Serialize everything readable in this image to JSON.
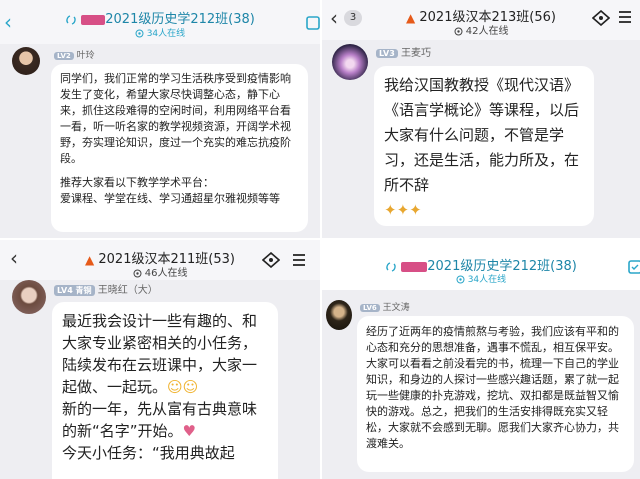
{
  "p1": {
    "title": "2021级历史学212班(38)",
    "online": "34人在线",
    "sender_badge": "LV2",
    "sender_name": "叶玲",
    "message": "同学们，我们正常的学习生活秩序受到疫情影响发生了变化，希望大家尽快调整心态，静下心来，抓住这段难得的空闲时间，利用网络平台看一看，听一听名家的教学视频资源，开阔学术视野，夯实理论知识，度过一个充实的难忘抗疫阶段。",
    "message2": "推荐大家看以下教学学术平台：\n爱课程、学堂在线、学习通超星尔雅视频等等"
  },
  "p2": {
    "unread": "3",
    "title": "2021级汉本213班(56)",
    "online": "42人在线",
    "sender_badge": "LV3",
    "sender_name": "王麦巧",
    "message": "我给汉国教教授《现代汉语》《语言学概论》等课程，以后大家有什么问题，不管是学习，还是生活，能力所及，在所不辞"
  },
  "p3": {
    "title": "2021级汉本211班(53)",
    "online": "46人在线",
    "sender_badge": "LV4 青铜",
    "sender_name": "王晓红（大）",
    "message": "最近我会设计一些有趣的、和大家专业紧密相关的小任务，陆续发布在云班课中，大家一起做、一起玩。",
    "message2": "新的一年，先从富有古典意味的新“名字”开始。",
    "message3": "今天小任务：“我用典故起"
  },
  "p4": {
    "title": "2021级历史学212班(38)",
    "online": "34人在线",
    "sender_badge": "LV6",
    "sender_name": "王文涛",
    "message": "经历了近两年的疫情煎熬与考验，我们应该有平和的心态和充分的思想准备，遇事不慌乱，相互保平安。大家可以看看之前没看完的书，梳理一下自己的学业知识，和身边的人探讨一些感兴趣话题，累了就一起玩一些健康的扑克游戏，挖坑、双扣都是既益智又愉快的游戏。总之，把我们的生活安排得既充实又轻松，大家就不会感到无聊。愿我们大家齐心协力，共渡难关。"
  },
  "colors": {
    "panel_bg": "#eeeef2",
    "header_bg": "#f6f6f9",
    "bubble_bg": "#ffffff",
    "accent_cyan": "#2aa6c9",
    "redaction_pink": "#d74f86",
    "level_badge": "#a6b4c8"
  },
  "icons": [
    "back-chevron-icon",
    "group-link-icon",
    "flame-icon",
    "signal-icon",
    "settings-icon",
    "menu-icon",
    "checklist-icon",
    "clapping-hands-emoji"
  ]
}
